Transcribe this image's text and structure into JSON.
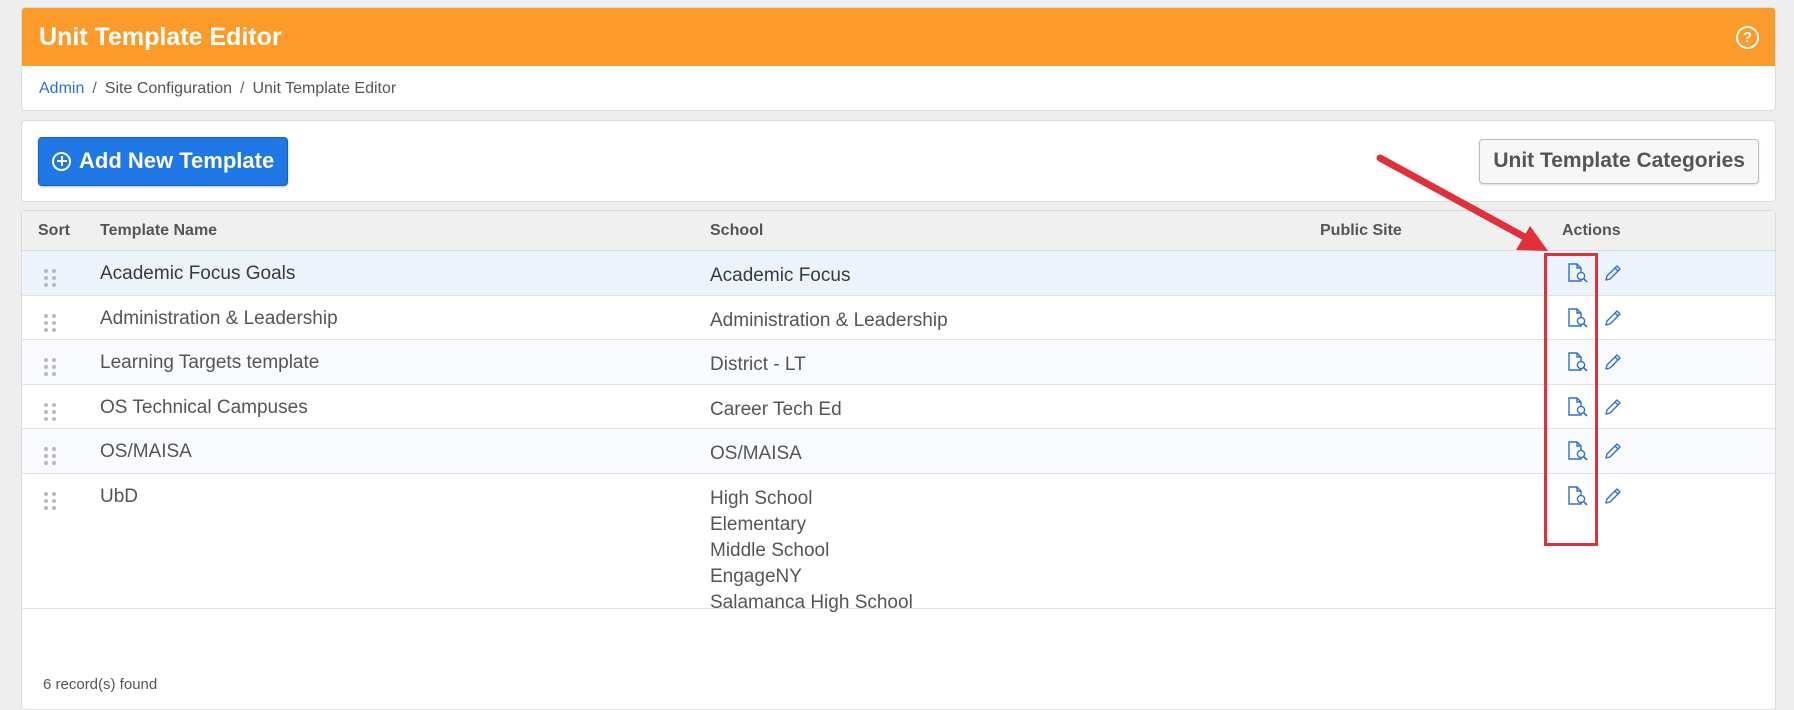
{
  "header": {
    "title": "Unit Template Editor",
    "help_icon": "?"
  },
  "breadcrumb": {
    "items": [
      "Admin",
      "Site Configuration",
      "Unit Template Editor"
    ],
    "separator": "/"
  },
  "toolbar": {
    "add_label": "Add New Template",
    "categories_label": "Unit Template Categories"
  },
  "table": {
    "columns": [
      "Sort",
      "Template Name",
      "School",
      "Public Site",
      "Actions"
    ],
    "rows": [
      {
        "name": "Academic Focus Goals",
        "schools": [
          "Academic Focus"
        ]
      },
      {
        "name": "Administration & Leadership",
        "schools": [
          "Administration & Leadership"
        ]
      },
      {
        "name": "Learning Targets template",
        "schools": [
          "District - LT"
        ]
      },
      {
        "name": "OS Technical Campuses",
        "schools": [
          "Career Tech Ed"
        ]
      },
      {
        "name": "OS/MAISA",
        "schools": [
          "OS/MAISA"
        ]
      },
      {
        "name": "UbD",
        "schools": [
          "High School",
          "Elementary",
          "Middle School",
          "EngageNY",
          "Salamanca High School"
        ]
      }
    ],
    "record_count": "6 record(s) found"
  },
  "icons": {
    "view": "document-preview-icon",
    "edit": "pencil-icon",
    "drag": "drag-handle-icon",
    "add": "plus-circle-icon",
    "help": "help-circle-icon"
  },
  "colors": {
    "header_bg": "#fd9b2a",
    "primary": "#1f78e6",
    "link": "#2f6fd4",
    "annotation": "#e0303a"
  }
}
